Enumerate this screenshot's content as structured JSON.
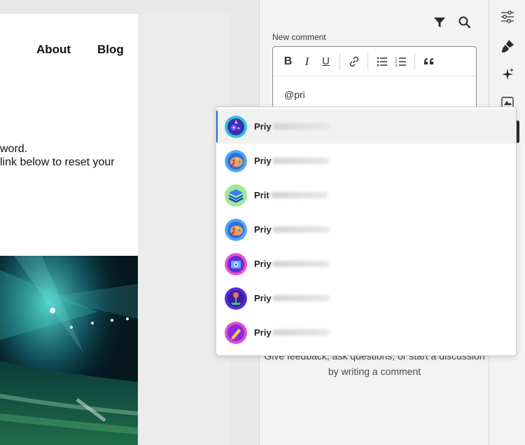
{
  "email_preview": {
    "nav": [
      "About",
      "Blog"
    ],
    "body_lines": [
      "word.",
      "link below to reset your"
    ]
  },
  "comments_panel": {
    "toolbar_icons": [
      "filter-icon",
      "search-icon"
    ],
    "new_comment_label": "New comment",
    "editor": {
      "formatting_buttons": [
        {
          "label": "B",
          "name": "bold"
        },
        {
          "label": "I",
          "name": "italic"
        },
        {
          "label": "U",
          "name": "underline"
        }
      ],
      "other_tools": [
        "link-icon",
        "bullet-list-icon",
        "numbered-list-icon",
        "quote-icon"
      ],
      "text": "@pri"
    },
    "empty_state": [
      "Give feedback, ask questions, or start a discussion",
      "by writing a comment"
    ]
  },
  "rail": {
    "icons": [
      "sliders-icon",
      "brush-icon",
      "sparkle-icon",
      "image-icon"
    ],
    "active_index": 3
  },
  "mention_suggestions": [
    {
      "visible_name": "Priy",
      "avatar": "app-icon-purple-blue",
      "selected": true
    },
    {
      "visible_name": "Priy",
      "avatar": "app-icon-palette-blue",
      "selected": false
    },
    {
      "visible_name": "Prit",
      "avatar": "app-icon-layers-green",
      "selected": false
    },
    {
      "visible_name": "Priy",
      "avatar": "app-icon-palette-blue",
      "selected": false
    },
    {
      "visible_name": "Priy",
      "avatar": "app-icon-camera-pink",
      "selected": false
    },
    {
      "visible_name": "Priy",
      "avatar": "app-icon-plant-purple",
      "selected": false
    },
    {
      "visible_name": "Priy",
      "avatar": "app-icon-pencil-pink",
      "selected": false
    }
  ],
  "colors": {
    "selection_accent": "#1473e6",
    "panel_background": "#f3f3f3"
  }
}
